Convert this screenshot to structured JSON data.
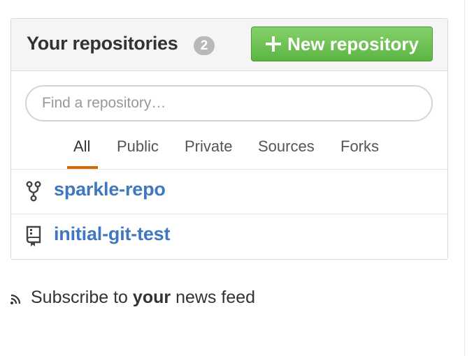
{
  "repos_box": {
    "title": "Your repositories",
    "count": "2",
    "new_button_label": "New repository",
    "filter_placeholder": "Find a repository…",
    "filter_value": "",
    "tabs": [
      {
        "label": "All",
        "selected": true
      },
      {
        "label": "Public",
        "selected": false
      },
      {
        "label": "Private",
        "selected": false
      },
      {
        "label": "Sources",
        "selected": false
      },
      {
        "label": "Forks",
        "selected": false
      }
    ],
    "repos": [
      {
        "name": "sparkle-repo",
        "icon": "repo-forked-icon"
      },
      {
        "name": "initial-git-test",
        "icon": "repo-icon"
      }
    ]
  },
  "news_feed": {
    "prefix": "Subscribe to",
    "emphasis": "your",
    "suffix": "news feed",
    "icon": "rss-icon"
  },
  "colors": {
    "link_blue": "#4078c0",
    "button_green": "#6cc644",
    "selected_tab_underline": "#d26911",
    "counter_gray": "#b8b8b8"
  }
}
